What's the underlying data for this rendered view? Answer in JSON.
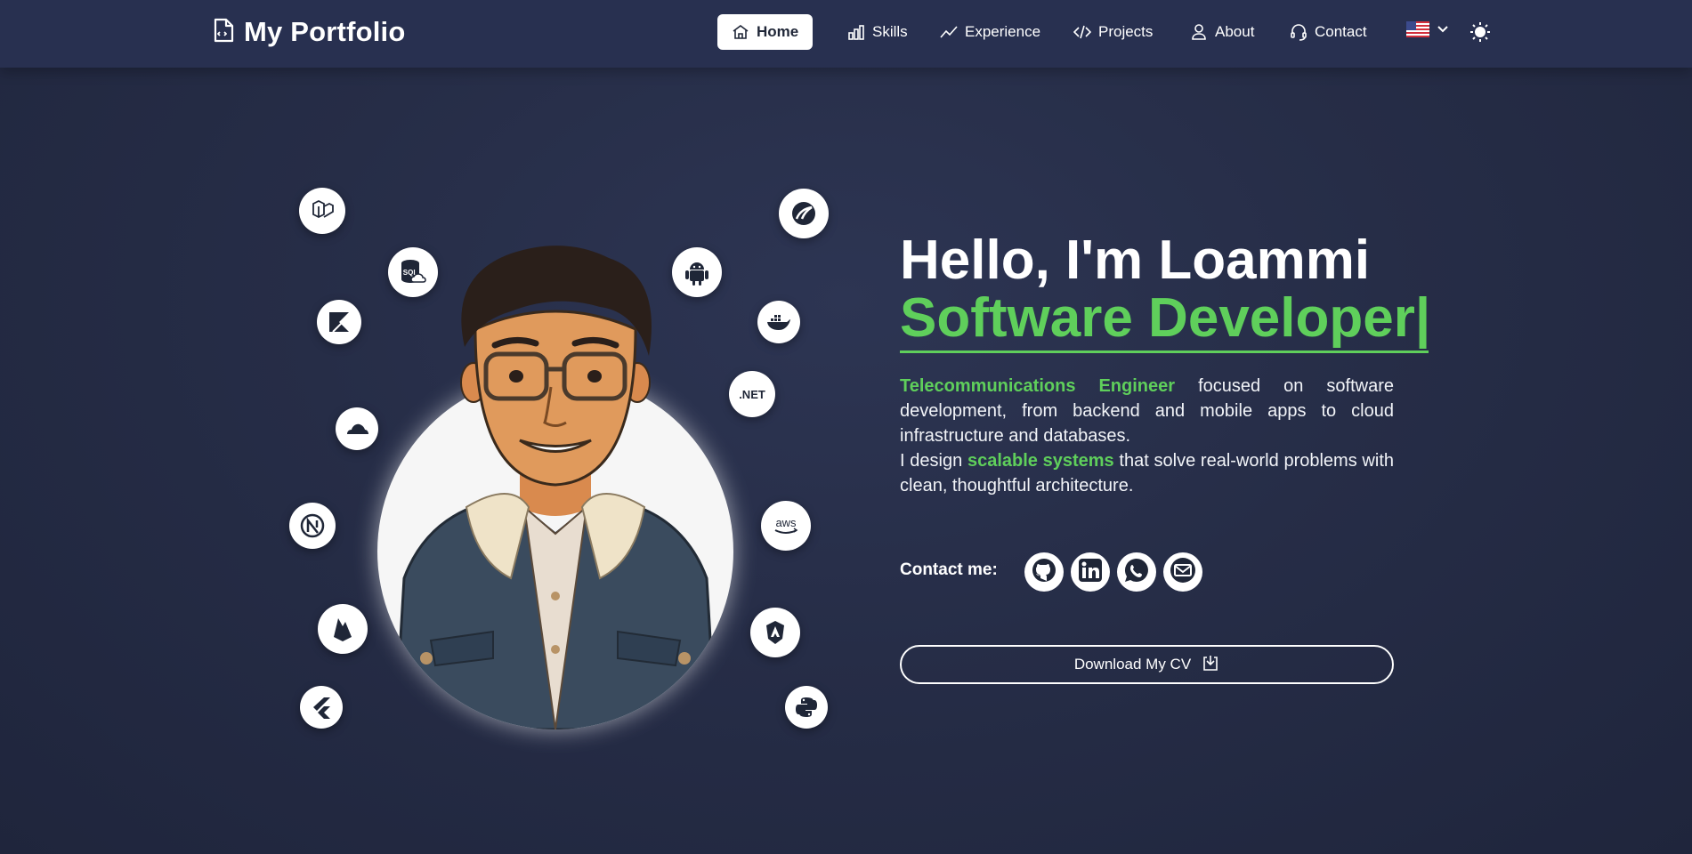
{
  "brand": {
    "title": "My Portfolio"
  },
  "nav": {
    "items": [
      {
        "label": "Home",
        "icon": "home-icon",
        "active": true
      },
      {
        "label": "Skills",
        "icon": "bar-chart-icon"
      },
      {
        "label": "Experience",
        "icon": "trend-line-icon"
      },
      {
        "label": "Projects",
        "icon": "code-icon"
      },
      {
        "label": "About",
        "icon": "user-icon"
      },
      {
        "label": "Contact",
        "icon": "headset-icon"
      }
    ],
    "language_flag": "us-flag-icon",
    "theme_icon": "sun-icon"
  },
  "tech_icons": [
    {
      "name": "laravel-icon"
    },
    {
      "name": "sql-cloud-icon",
      "text": "SQL"
    },
    {
      "name": "kotlin-icon"
    },
    {
      "name": "cloudflare-icon"
    },
    {
      "name": "nextjs-icon"
    },
    {
      "name": "firebase-icon"
    },
    {
      "name": "flutter-icon"
    },
    {
      "name": "spring-icon"
    },
    {
      "name": "android-icon"
    },
    {
      "name": "docker-icon"
    },
    {
      "name": "dotnet-icon",
      "text": ".NET"
    },
    {
      "name": "aws-icon",
      "text": "aws"
    },
    {
      "name": "nestjs-icon"
    },
    {
      "name": "python-icon"
    }
  ],
  "hero": {
    "greeting": "Hello, I'm Loammi",
    "role": "Software Developer|",
    "desc": {
      "hl1": "Telecommunications Engineer",
      "t1": " focused on software development, from backend and mobile apps to cloud infrastructure and databases.",
      "t2": "I design ",
      "hl2": "scalable systems",
      "t3": " that solve real-world problems with clean, thoughtful architecture."
    }
  },
  "contact": {
    "label": "Contact me:",
    "links": [
      {
        "name": "github-icon"
      },
      {
        "name": "linkedin-icon"
      },
      {
        "name": "whatsapp-icon"
      },
      {
        "name": "email-icon"
      }
    ]
  },
  "cv": {
    "label": "Download My CV",
    "icon": "download-icon"
  },
  "colors": {
    "accent": "#5fcf5b",
    "background": "#262d47",
    "navbar": "#283050"
  }
}
